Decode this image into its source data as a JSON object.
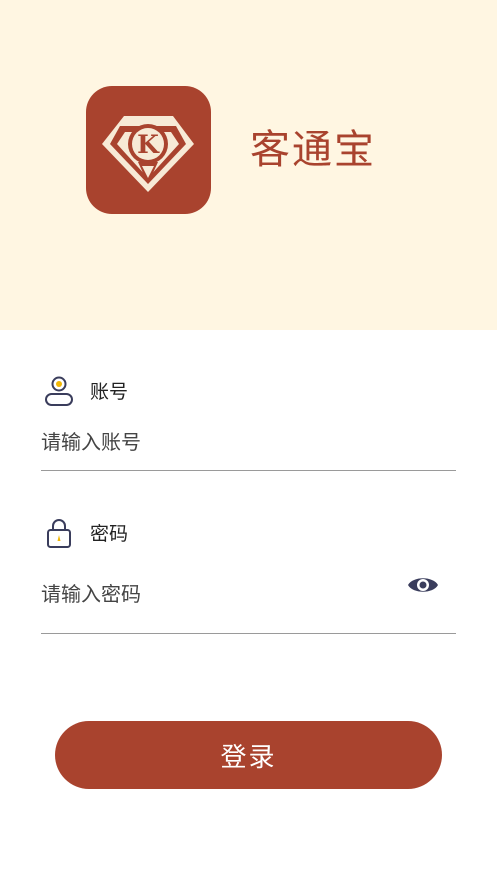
{
  "app": {
    "name": "客通宝",
    "logo_letter": "K",
    "brand_color": "#a9432e",
    "header_bg": "#fff6e2"
  },
  "account": {
    "label": "账号",
    "placeholder": "请输入账号",
    "icon": "user-icon"
  },
  "password": {
    "label": "密码",
    "placeholder": "请输入密码",
    "icon": "lock-icon",
    "toggle_icon": "eye-icon"
  },
  "login": {
    "label": "登录"
  }
}
